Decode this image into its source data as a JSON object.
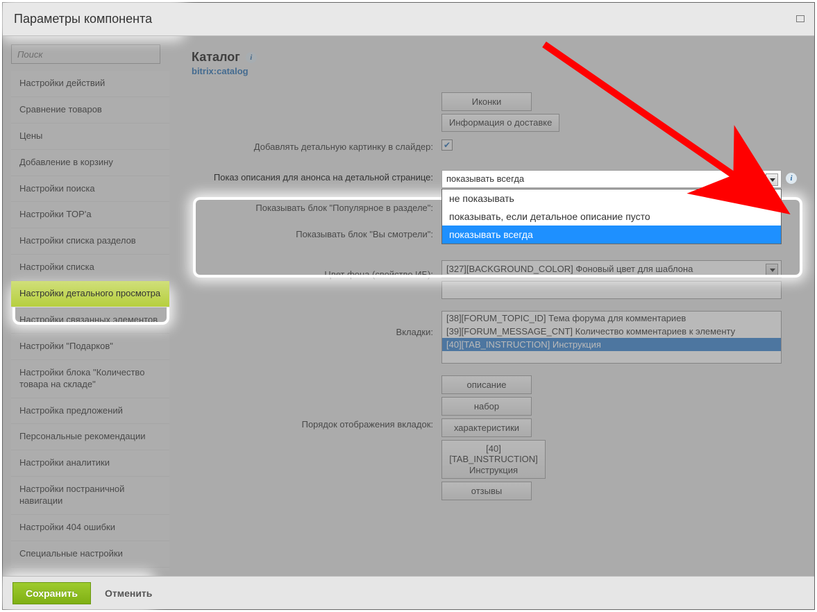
{
  "title": "Параметры компонента",
  "search_placeholder": "Поиск",
  "sidebar": {
    "items": [
      "Настройки действий",
      "Сравнение товаров",
      "Цены",
      "Добавление в корзину",
      "Настройки поиска",
      "Настройки TOP'а",
      "Настройки списка разделов",
      "Настройки списка",
      "Настройки детального просмотра",
      "Настройки связанных элементов",
      "Настройки \"Подарков\"",
      "Настройки блока \"Количество товара на складе\"",
      "Настройка предложений",
      "Персональные рекомендации",
      "Настройки аналитики",
      "Настройки постраничной навигации",
      "Настройки 404 ошибки",
      "Специальные настройки"
    ],
    "active_index": 8
  },
  "heading": "Каталог",
  "component_id": "bitrix:catalog",
  "buttons_top": {
    "icons": "Иконки",
    "delivery": "Информация о доставке"
  },
  "rows": {
    "add_detail_pic": {
      "label": "Добавлять детальную картинку в слайдер:",
      "checked": true
    },
    "anons_display": {
      "label": "Показ описания для анонса на детальной странице:",
      "value": "показывать всегда",
      "options": [
        "не показывать",
        "показывать, если детальное описание пусто",
        "показывать всегда"
      ],
      "selected_index": 2
    },
    "popular_block": {
      "label": "Показывать блок \"Популярное в разделе\":",
      "checked": true
    },
    "viewed_block": {
      "label": "Показывать блок \"Вы смотрели\":",
      "checked": true
    },
    "bg_color": {
      "label": "Цвет фона (свойство ИБ):",
      "value": "[327][BACKGROUND_COLOR] Фоновый цвет для шаблона"
    },
    "tabs": {
      "label": "Вкладки:",
      "options": [
        "[38][FORUM_TOPIC_ID] Тема форума для комментариев",
        "[39][FORUM_MESSAGE_CNT] Количество комментариев к элементу",
        "[40][TAB_INSTRUCTION] Инструкция"
      ],
      "selected_index": 2
    },
    "tab_order": {
      "label": "Порядок отображения вкладок:",
      "buttons": [
        "описание",
        "набор",
        "характеристики"
      ],
      "current": "[40][TAB_INSTRUCTION] Инструкция",
      "after": [
        "отзывы"
      ]
    }
  },
  "footer": {
    "save": "Сохранить",
    "cancel": "Отменить"
  },
  "icon_info": "i"
}
